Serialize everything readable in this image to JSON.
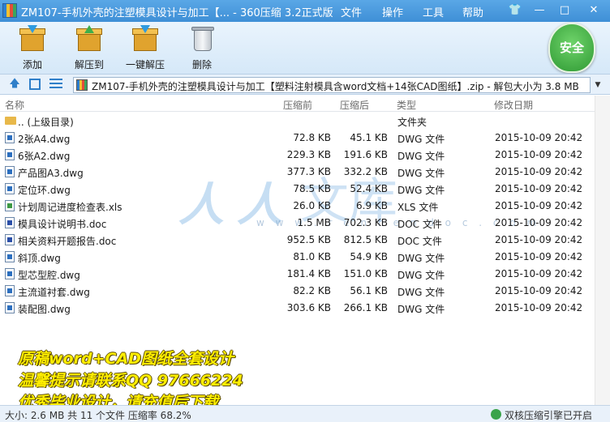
{
  "window": {
    "title": "ZM107-手机外壳的注塑模具设计与加工【... - 360压缩 3.2正式版",
    "menu": [
      "文件",
      "操作",
      "工具",
      "帮助"
    ]
  },
  "toolbar": {
    "add": "添加",
    "extract": "解压到",
    "one_click": "一键解压",
    "delete": "删除",
    "security": "安全"
  },
  "address": {
    "path": "ZM107-手机外壳的注塑模具设计与加工【塑料注射模具含word文档+14张CAD图纸】.zip - 解包大小为 3.8 MB"
  },
  "columns": {
    "name": "名称",
    "packed": "压缩前",
    "size": "压缩后",
    "type": "类型",
    "modified": "修改日期"
  },
  "parent": {
    "name": ".. (上级目录)",
    "type": "文件夹"
  },
  "files": [
    {
      "name": "2张A4.dwg",
      "packed": "72.8 KB",
      "size": "45.1 KB",
      "type": "DWG 文件",
      "date": "2015-10-09 20:42",
      "icon": "dwg-file-icon"
    },
    {
      "name": "6张A2.dwg",
      "packed": "229.3 KB",
      "size": "191.6 KB",
      "type": "DWG 文件",
      "date": "2015-10-09 20:42",
      "icon": "dwg-file-icon"
    },
    {
      "name": "产品图A3.dwg",
      "packed": "377.3 KB",
      "size": "332.2 KB",
      "type": "DWG 文件",
      "date": "2015-10-09 20:42",
      "icon": "dwg-file-icon"
    },
    {
      "name": "定位环.dwg",
      "packed": "78.5 KB",
      "size": "52.4 KB",
      "type": "DWG 文件",
      "date": "2015-10-09 20:42",
      "icon": "dwg-file-icon"
    },
    {
      "name": "计划周记进度检查表.xls",
      "packed": "26.0 KB",
      "size": "6.9 KB",
      "type": "XLS 文件",
      "date": "2015-10-09 20:42",
      "icon": "xls-file-icon"
    },
    {
      "name": "模具设计说明书.doc",
      "packed": "1.5 MB",
      "size": "702.3 KB",
      "type": "DOC 文件",
      "date": "2015-10-09 20:42",
      "icon": "doc-file-icon"
    },
    {
      "name": "相关资料开题报告.doc",
      "packed": "952.5 KB",
      "size": "812.5 KB",
      "type": "DOC 文件",
      "date": "2015-10-09 20:42",
      "icon": "doc-file-icon"
    },
    {
      "name": "斜顶.dwg",
      "packed": "81.0 KB",
      "size": "54.9 KB",
      "type": "DWG 文件",
      "date": "2015-10-09 20:42",
      "icon": "dwg-file-icon"
    },
    {
      "name": "型芯型腔.dwg",
      "packed": "181.4 KB",
      "size": "151.0 KB",
      "type": "DWG 文件",
      "date": "2015-10-09 20:42",
      "icon": "dwg-file-icon"
    },
    {
      "name": "主流道衬套.dwg",
      "packed": "82.2 KB",
      "size": "56.1 KB",
      "type": "DWG 文件",
      "date": "2015-10-09 20:42",
      "icon": "dwg-file-icon"
    },
    {
      "name": "装配图.dwg",
      "packed": "303.6 KB",
      "size": "266.1 KB",
      "type": "DWG 文件",
      "date": "2015-10-09 20:42",
      "icon": "dwg-file-icon"
    }
  ],
  "watermark": {
    "ren1": "人",
    "ren2": "人",
    "wen": "文",
    "ku": "库",
    "url": "w w w . r e n r e n d o c . c o m"
  },
  "promo": [
    "原稿word+CAD图纸全套设计",
    "温馨提示请联系QQ 97666224",
    "优秀毕业设计，请充值后下载"
  ],
  "status": {
    "summary": "大小: 2.6 MB 共 11 个文件 压缩率 68.2%",
    "engine": "双核压缩引擎已开启"
  },
  "colors": {
    "titlebar": "#4a9be0",
    "toolbar": "#dcecf9",
    "shield": "#3aa83d",
    "promo": "#ffee00"
  }
}
